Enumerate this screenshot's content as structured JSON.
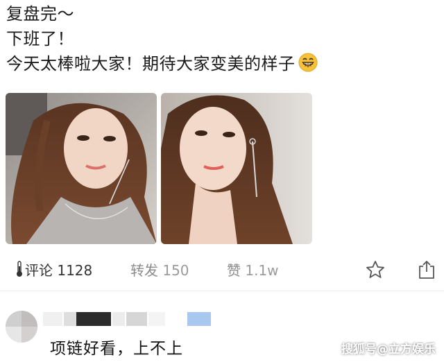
{
  "post": {
    "lines": [
      "复盘完～",
      "下班了！",
      "今天太棒啦大家！期待大家变美的样子"
    ],
    "emoji": "grinning-face-emoji"
  },
  "photos": [
    {
      "alt": "photo-1"
    },
    {
      "alt": "photo-2"
    }
  ],
  "actions": {
    "comment_label": "评论",
    "comment_count": "1128",
    "repost_label": "转发",
    "repost_count": "150",
    "like_label": "赞",
    "like_count": "1.1w"
  },
  "comment": {
    "text": "项链好看，上不上"
  },
  "watermark": "搜狐号@立方娱乐",
  "colors": {
    "text": "#1a1a1a",
    "muted": "#8a8a8a",
    "divider": "#ececec"
  }
}
